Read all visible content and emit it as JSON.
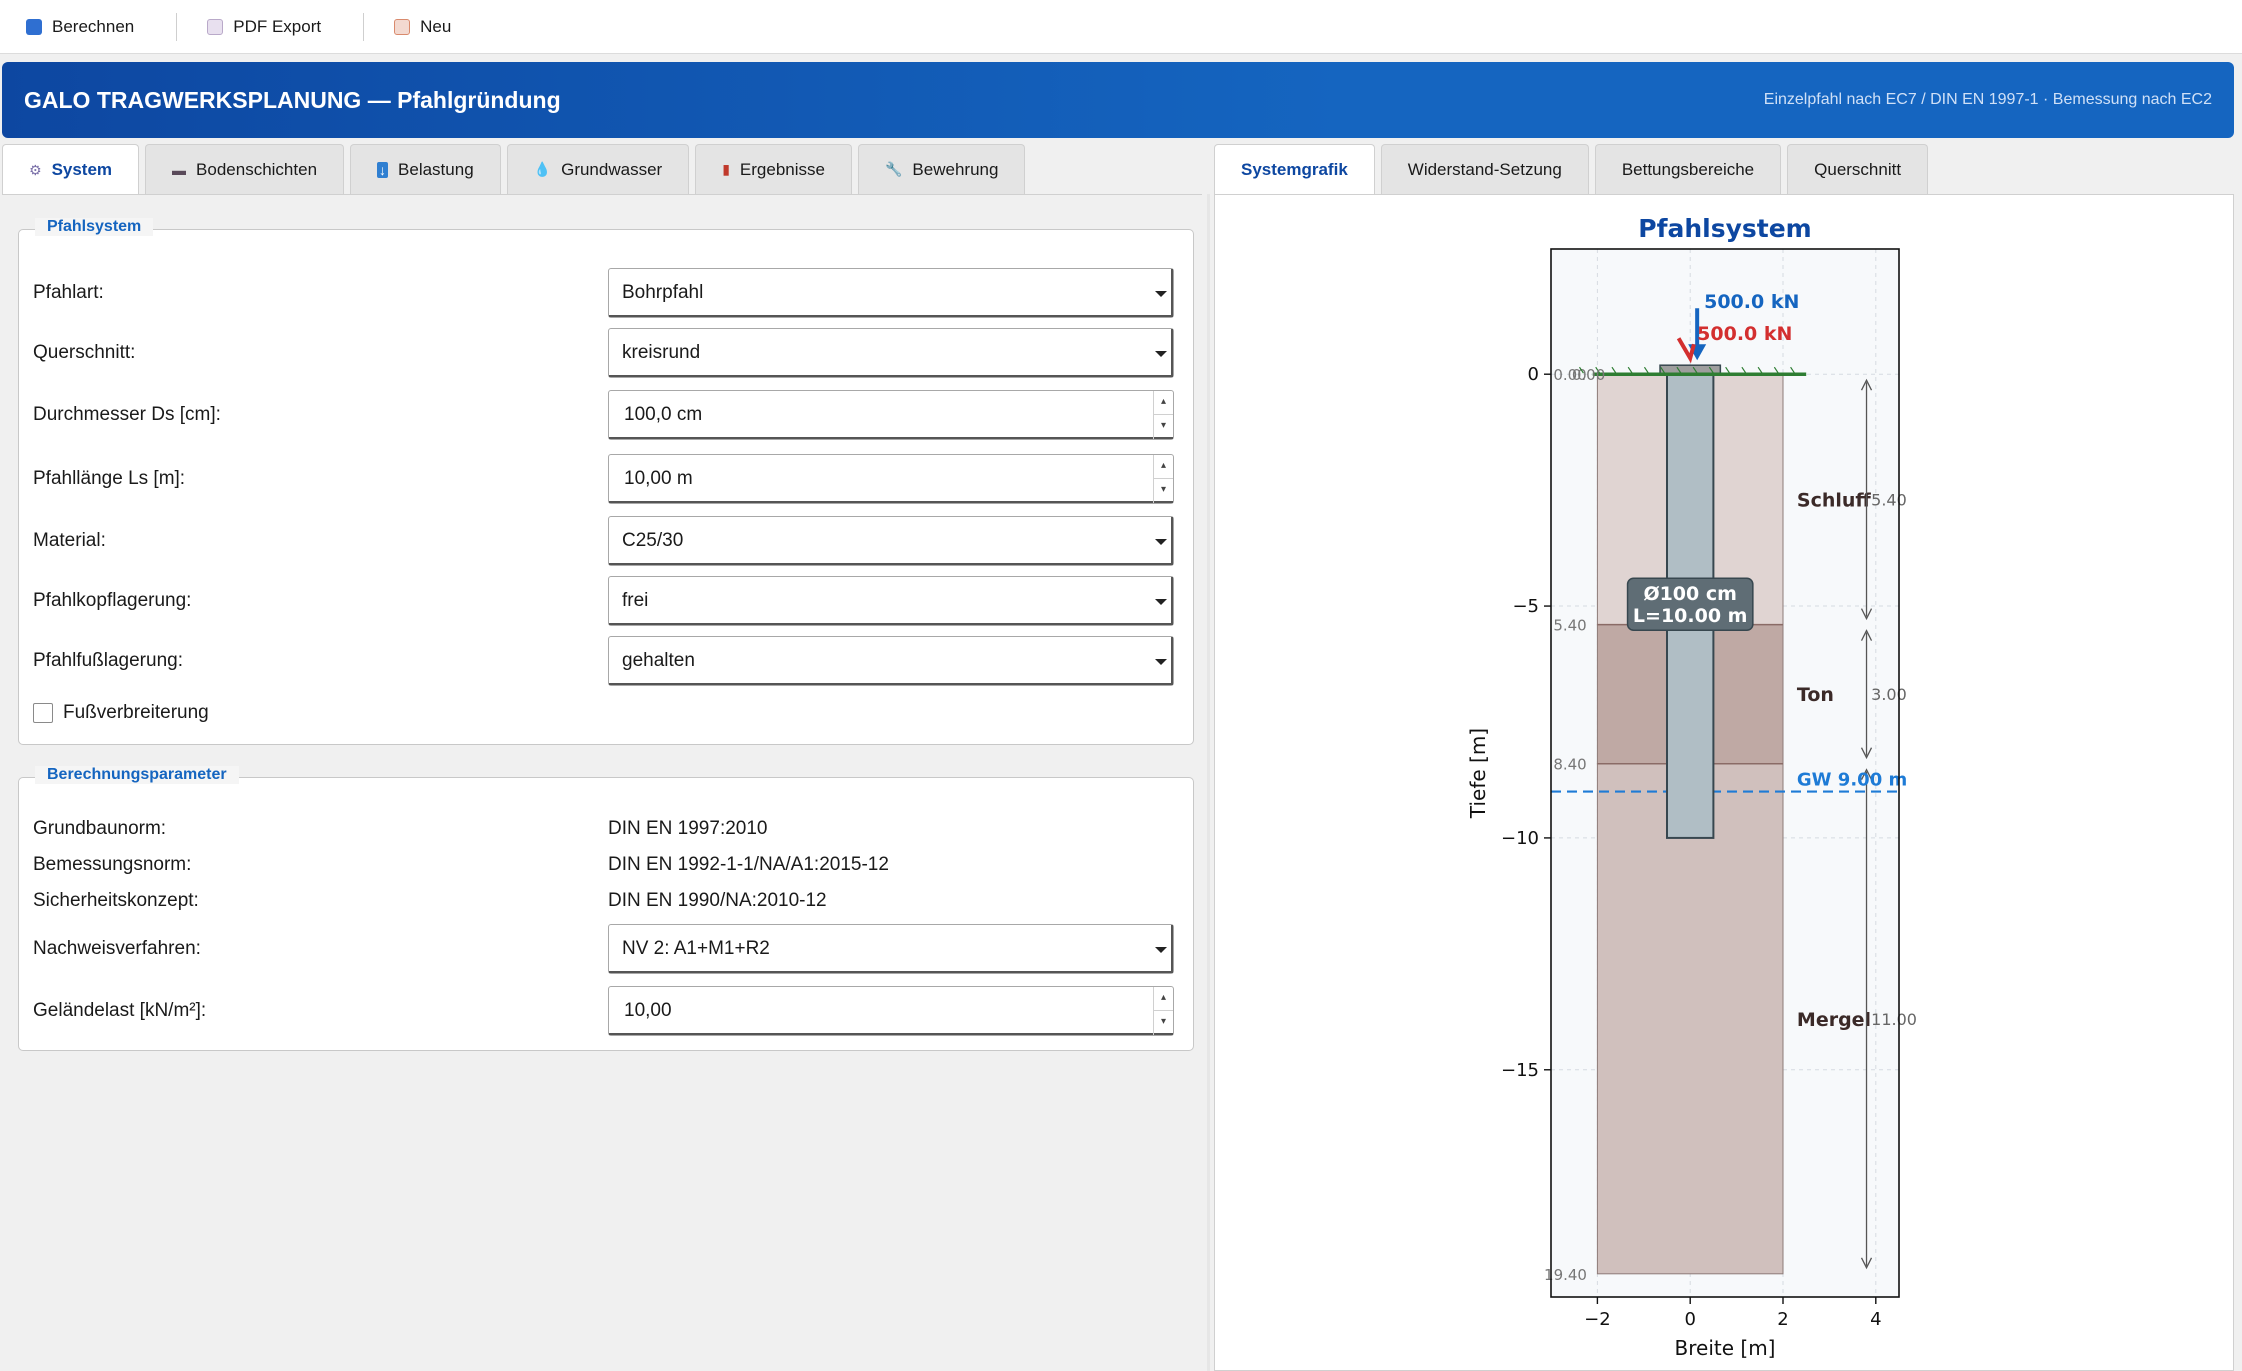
{
  "toolbar": {
    "calc": "Berechnen",
    "pdf": "PDF Export",
    "new": "Neu"
  },
  "banner": {
    "title": "GALO TRAGWERKSPLANUNG — Pfahlgründung",
    "subtitle": "Einzelpfahl nach EC7 / DIN EN 1997-1 · Bemessung nach EC2"
  },
  "left_tabs": [
    {
      "label": "System",
      "icon": "gear-icon"
    },
    {
      "label": "Bodenschichten",
      "icon": "soil-icon"
    },
    {
      "label": "Belastung",
      "icon": "down-arrow-icon"
    },
    {
      "label": "Grundwasser",
      "icon": "water-drop-icon"
    },
    {
      "label": "Ergebnisse",
      "icon": "bar-chart-icon"
    },
    {
      "label": "Bewehrung",
      "icon": "wrench-icon"
    }
  ],
  "right_tabs": [
    "Systemgrafik",
    "Widerstand-Setzung",
    "Bettungsbereiche",
    "Querschnitt"
  ],
  "pfahlsystem": {
    "title": "Pfahlsystem",
    "pfahlart_label": "Pfahlart:",
    "pfahlart_value": "Bohrpfahl",
    "querschnitt_label": "Querschnitt:",
    "querschnitt_value": "kreisrund",
    "durchmesser_label": "Durchmesser Ds [cm]:",
    "durchmesser_value": "100,0 cm",
    "laenge_label": "Pfahllänge Ls [m]:",
    "laenge_value": "10,00 m",
    "material_label": "Material:",
    "material_value": "C25/30",
    "kopf_label": "Pfahlkopflagerung:",
    "kopf_value": "frei",
    "fuss_label": "Pfahlfußlagerung:",
    "fuss_value": "gehalten",
    "fussverbreiterung_label": "Fußverbreiterung",
    "fussverbreiterung_checked": false
  },
  "berechnung": {
    "title": "Berechnungsparameter",
    "grundbau_label": "Grundbaunorm:",
    "grundbau_value": "DIN EN 1997:2010",
    "bemessung_label": "Bemessungsnorm:",
    "bemessung_value": "DIN EN 1992-1-1/NA/A1:2015-12",
    "sicherheit_label": "Sicherheitskonzept:",
    "sicherheit_value": "DIN EN 1990/NA:2010-12",
    "nachweis_label": "Nachweisverfahren:",
    "nachweis_value": "NV 2: A1+M1+R2",
    "gelaende_label": "Geländelast [kN/m²]:",
    "gelaende_value": "10,00"
  },
  "chart_data": {
    "type": "diagram",
    "title": "Pfahlsystem",
    "xlabel": "Breite [m]",
    "ylabel": "Tiefe [m]",
    "xlim": [
      -3,
      4.5
    ],
    "ylim": [
      -19.9,
      2.7
    ],
    "xticks": [
      -2,
      0,
      2,
      4
    ],
    "yticks": [
      0,
      -5,
      -10,
      -15
    ],
    "xtick_labels": [
      "−2",
      "0",
      "2",
      "4"
    ],
    "ytick_labels": [
      "0",
      "−5",
      "−10",
      "−15"
    ],
    "layers": [
      {
        "name": "Schluff",
        "top": 0.0,
        "bottom": -5.4,
        "thickness_label": "5.40",
        "top_label": "0.00",
        "color": "#e0d4d2"
      },
      {
        "name": "Ton",
        "top": -5.4,
        "bottom": -8.4,
        "thickness_label": "3.00",
        "top_label": "5.40",
        "color": "#bfa9a4"
      },
      {
        "name": "Mergel",
        "top": -8.4,
        "bottom": -19.4,
        "thickness_label": "11.00",
        "top_label": "8.40",
        "color": "#d0c0bd"
      }
    ],
    "bottom_label": "19.40",
    "layer_x": [
      -2,
      2
    ],
    "pile": {
      "diameter_m": 1.0,
      "length_m": 10.0,
      "label_line1": "Ø100 cm",
      "label_line2": "L=10.00 m",
      "color": "#b0bec5"
    },
    "groundwater": {
      "depth": -9.0,
      "label": "GW 9.00 m",
      "color": "#1e7bd6"
    },
    "loads": [
      {
        "label": "500.0 kN",
        "color": "#1565c0"
      },
      {
        "label": "500.0 kN",
        "color": "#d32f2f"
      }
    ],
    "surface_color": "#2e7d32",
    "grid": true
  }
}
